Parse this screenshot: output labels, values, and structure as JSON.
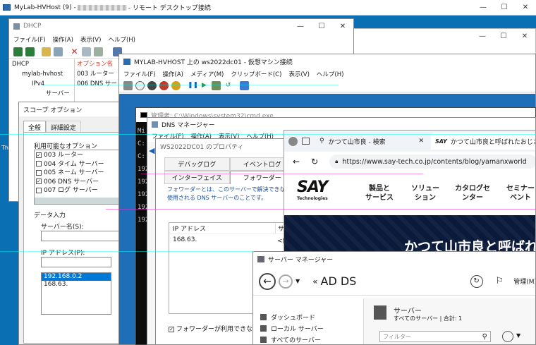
{
  "rdp_top": {
    "title_left": "MyLab-HVHost (9) - ",
    "title_right": " - リモート デスクトップ接続"
  },
  "dhcp": {
    "title": "DHCP",
    "menu": [
      "ファイル(F)",
      "操作(A)",
      "表示(V)",
      "ヘルプ(H)"
    ],
    "tree": [
      "DHCP",
      "mylab-hvhost",
      "IPv4",
      "サーバー"
    ],
    "col_header": "オプション名",
    "options": [
      "003 ルーター",
      "006 DNS サー"
    ]
  },
  "scope_dialog": {
    "title": "スコープ オプション",
    "tabs": [
      "全般",
      "詳細設定"
    ],
    "available_label": "利用可能なオプション",
    "options": [
      {
        "checked": true,
        "label": "003 ルーター"
      },
      {
        "checked": false,
        "label": "004 タイム サーバー"
      },
      {
        "checked": false,
        "label": "005 ネーム サーバー"
      },
      {
        "checked": true,
        "label": "006 DNS サーバー"
      },
      {
        "checked": false,
        "label": "007 ログ サーバー"
      }
    ],
    "data_input_label": "データ入力",
    "server_name_label": "サーバー名(S):",
    "ip_label": "IP アドレス(P):",
    "ip_list": [
      "192.168.0.2",
      "168.63."
    ]
  },
  "vm": {
    "title": "MYLAB-HVHOST 上の ws2022dc01 - 仮想マシン接続",
    "menu": [
      "ファイル(F)",
      "操作(A)",
      "メディア(M)",
      "クリップボード(C)",
      "表示(V)",
      "ヘルプ(H)"
    ]
  },
  "cmd": {
    "title": "管理者: C:\\Windows\\system32\\cmd.exe",
    "lines": [
      "Mi",
      "C:",
      "",
      "C:",
      "",
      "192",
      "192",
      "192",
      "192",
      "192"
    ]
  },
  "dns": {
    "title": "DNS マネージャー",
    "menu": [
      "ファイル(F)",
      "操作(A)",
      "表示(V)",
      "ヘルプ(H)"
    ],
    "props_title": "WS2022DC01 のプロパティ",
    "tabs_row1": [
      "デバッグログ",
      "イベントログ"
    ],
    "tabs_row2": [
      "インターフェイス",
      "フォワーダー"
    ],
    "desc_line1": "フォワーダーとは、このサーバーで解決できないレコー",
    "desc_line2": "使用される DNS サーバーのことです。",
    "table_col1": "IP アドレス",
    "table_col2": "サー",
    "row_ip": "168.63.",
    "row_val": "<解",
    "checkbox_label": "フォワーダーが利用できない場合"
  },
  "browser": {
    "tab1": "かつて山市良 - 検索",
    "tab2": "かつて山市良と呼ばれたおじさ",
    "url": "https://www.say-tech.co.jp/contents/blog/yamanxworld",
    "logo_text": "SAY",
    "logo_sub": "Technologies",
    "nav": [
      [
        "製品と",
        "サービス"
      ],
      [
        "ソリュー",
        "ション"
      ],
      [
        "カタログセ",
        "ンター"
      ],
      [
        "セミナー",
        "ベント"
      ]
    ],
    "banner": "かつて山市良と呼ばれ"
  },
  "server_manager": {
    "title": "サーバー マネージャー",
    "breadcrumb": "AD DS",
    "manage": "管理(M)",
    "nav": [
      "ダッシュボード",
      "ローカル サーバー",
      "すべてのサーバー"
    ],
    "servers_title": "サーバー",
    "servers_sub": "すべてのサーバー | 合計: 1",
    "filter_placeholder": "フィルター"
  },
  "colors": {
    "desktop": "#0a6fb3",
    "selection": "#0078d7",
    "banner": "#0b1a3a",
    "glitch_cyan": "#00ffff",
    "glitch_magenta": "#ff2bd6"
  }
}
